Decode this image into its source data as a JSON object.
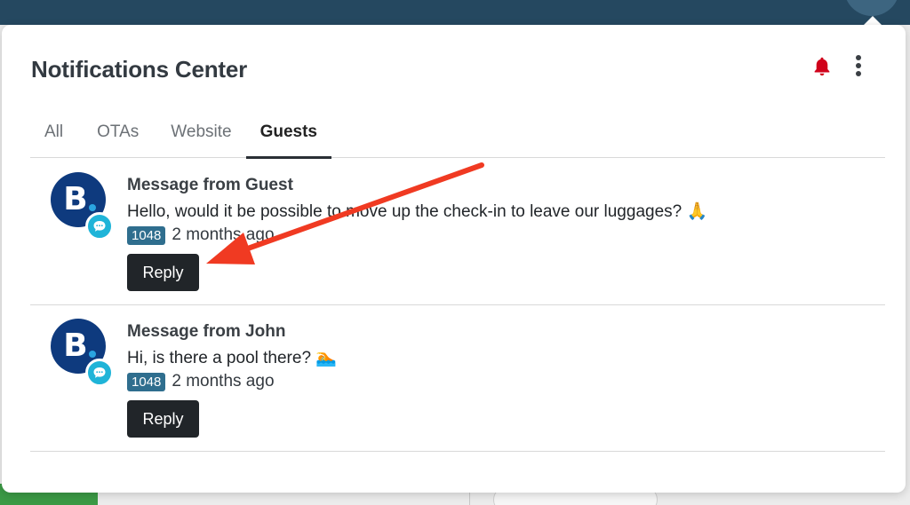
{
  "popover": {
    "title": "Notifications Center"
  },
  "header_icons": {
    "bell": "bell-icon",
    "menu": "kebab-menu-icon",
    "bell_color": "#d0021b"
  },
  "tabs": [
    {
      "label": "All",
      "active": false
    },
    {
      "label": "OTAs",
      "active": false
    },
    {
      "label": "Website",
      "active": false
    },
    {
      "label": "Guests",
      "active": true
    }
  ],
  "notifications": [
    {
      "avatar_letter": "B",
      "title": "Message from Guest",
      "body": "Hello, would it be possible to move up the check-in to leave our luggages? 🙏",
      "badge": "1048",
      "time": "2 months ago",
      "reply_label": "Reply"
    },
    {
      "avatar_letter": "B",
      "title": "Message from John",
      "body": "Hi, is there a pool there? 🏊",
      "badge": "1048",
      "time": "2 months ago",
      "reply_label": "Reply"
    }
  ],
  "colors": {
    "topbar": "#254860",
    "avatar": "#0e3a7e",
    "chat_badge": "#1fb4d8",
    "id_badge": "#2f6e8e",
    "button": "#212529",
    "annotation_arrow": "#f03a22"
  }
}
